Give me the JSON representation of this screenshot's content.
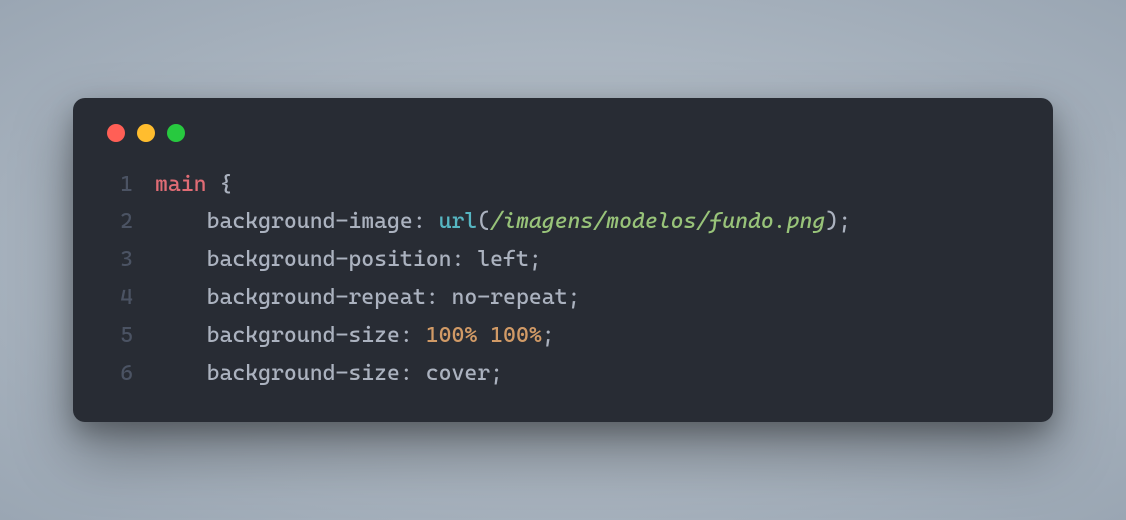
{
  "window": {
    "traffic_lights": {
      "red": "#ff5f56",
      "yellow": "#ffbd2e",
      "green": "#27c93f"
    }
  },
  "code": {
    "language": "css",
    "lines": [
      {
        "n": "1",
        "tokens": [
          {
            "t": "main ",
            "c": "sel"
          },
          {
            "t": "{",
            "c": "brace"
          }
        ]
      },
      {
        "n": "2",
        "tokens": [
          {
            "t": "    ",
            "c": "punc"
          },
          {
            "t": "background-image",
            "c": "prop"
          },
          {
            "t": ": ",
            "c": "colon"
          },
          {
            "t": "url",
            "c": "func"
          },
          {
            "t": "(",
            "c": "punc"
          },
          {
            "t": "/imagens/modelos/fundo.png",
            "c": "str"
          },
          {
            "t": ")",
            "c": "punc"
          },
          {
            "t": ";",
            "c": "punc"
          }
        ]
      },
      {
        "n": "3",
        "tokens": [
          {
            "t": "    ",
            "c": "punc"
          },
          {
            "t": "background-position",
            "c": "prop"
          },
          {
            "t": ": ",
            "c": "colon"
          },
          {
            "t": "left",
            "c": "val"
          },
          {
            "t": ";",
            "c": "punc"
          }
        ]
      },
      {
        "n": "4",
        "tokens": [
          {
            "t": "    ",
            "c": "punc"
          },
          {
            "t": "background-repeat",
            "c": "prop"
          },
          {
            "t": ": ",
            "c": "colon"
          },
          {
            "t": "no-repeat",
            "c": "val"
          },
          {
            "t": ";",
            "c": "punc"
          }
        ]
      },
      {
        "n": "5",
        "tokens": [
          {
            "t": "    ",
            "c": "punc"
          },
          {
            "t": "background-size",
            "c": "prop"
          },
          {
            "t": ": ",
            "c": "colon"
          },
          {
            "t": "100%",
            "c": "num"
          },
          {
            "t": " ",
            "c": "punc"
          },
          {
            "t": "100%",
            "c": "num"
          },
          {
            "t": ";",
            "c": "punc"
          }
        ]
      },
      {
        "n": "6",
        "tokens": [
          {
            "t": "    ",
            "c": "punc"
          },
          {
            "t": "background-size",
            "c": "prop"
          },
          {
            "t": ": ",
            "c": "colon"
          },
          {
            "t": "cover",
            "c": "val"
          },
          {
            "t": ";",
            "c": "punc"
          }
        ]
      }
    ]
  }
}
